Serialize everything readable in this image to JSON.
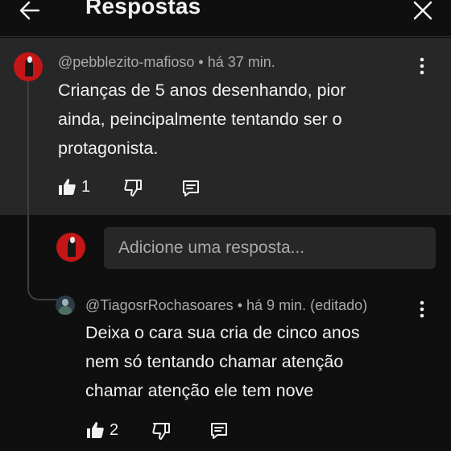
{
  "header": {
    "title": "Respostas",
    "back_icon": "arrow-left-icon",
    "close_icon": "close-icon"
  },
  "parent_comment": {
    "author": "@pebblezito-mafioso",
    "time": "há 37 min.",
    "text_lines": [
      "Crianças de 5 anos desenhando, pior",
      "ainda, peincipalmente tentando ser o",
      "protagonista."
    ],
    "likes": "1"
  },
  "reply_box": {
    "placeholder": "Adicione uma resposta..."
  },
  "reply_comment": {
    "author": "@TiagosrRochasoares",
    "time": "há 9 min. (editado)",
    "text_lines": [
      "Deixa o cara sua cria de cinco anos",
      "nem só tentando chamar atenção",
      "chamar atenção ele tem nove"
    ],
    "likes": "2"
  },
  "colors": {
    "background": "#0f0f0f",
    "highlight": "#272727",
    "text_primary": "#f1f1f1",
    "text_secondary": "#aaaaaa",
    "avatar_red": "#c41616"
  }
}
